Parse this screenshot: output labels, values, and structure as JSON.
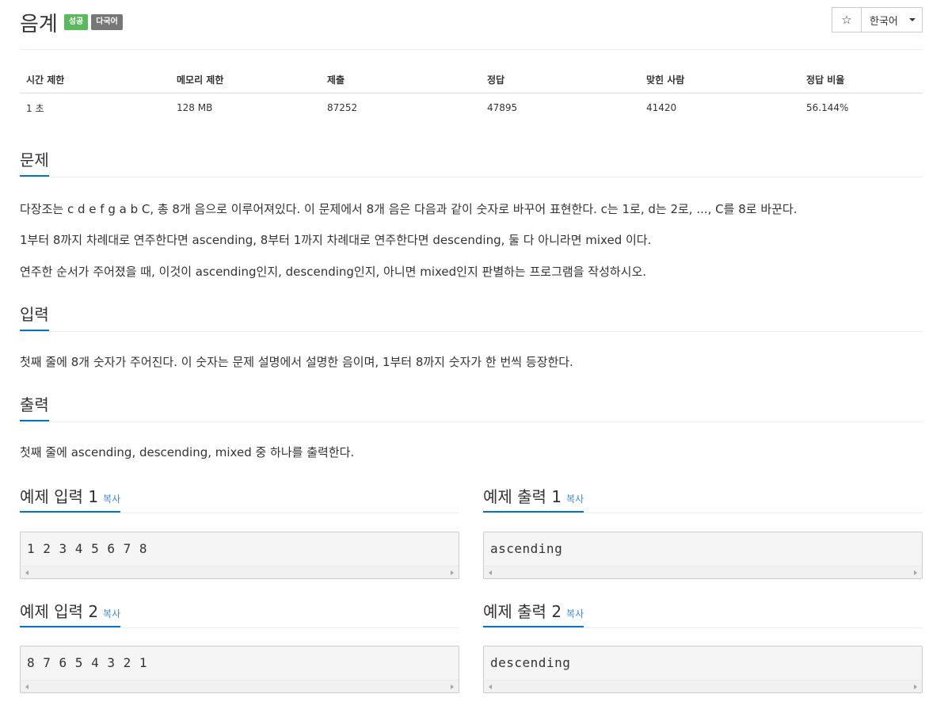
{
  "header": {
    "title": "음계",
    "badge_success": "성공",
    "badge_multilang": "다국어",
    "star_label": "☆",
    "lang_label": "한국어"
  },
  "info_table": {
    "headers": [
      "시간 제한",
      "메모리 제한",
      "제출",
      "정답",
      "맞힌 사람",
      "정답 비율"
    ],
    "values": [
      "1 초",
      "128 MB",
      "87252",
      "47895",
      "41420",
      "56.144%"
    ]
  },
  "sections": {
    "problem_title": "문제",
    "problem_p1": "다장조는 c d e f g a b C, 총 8개 음으로 이루어져있다. 이 문제에서 8개 음은 다음과 같이 숫자로 바꾸어 표현한다. c는 1로, d는 2로, ..., C를 8로 바꾼다.",
    "problem_p2": "1부터 8까지 차례대로 연주한다면 ascending, 8부터 1까지 차례대로 연주한다면 descending, 둘 다 아니라면 mixed 이다.",
    "problem_p3": "연주한 순서가 주어졌을 때, 이것이 ascending인지, descending인지, 아니면 mixed인지 판별하는 프로그램을 작성하시오.",
    "input_title": "입력",
    "input_p": "첫째 줄에 8개 숫자가 주어진다. 이 숫자는 문제 설명에서 설명한 음이며, 1부터 8까지 숫자가 한 번씩 등장한다.",
    "output_title": "출력",
    "output_p": "첫째 줄에 ascending, descending, mixed 중 하나를 출력한다."
  },
  "examples": {
    "copy_label": "복사",
    "in1_title": "예제 입력 1",
    "in1_code": "1 2 3 4 5 6 7 8",
    "out1_title": "예제 출력 1",
    "out1_code": "ascending",
    "in2_title": "예제 입력 2",
    "in2_code": "8 7 6 5 4 3 2 1",
    "out2_title": "예제 출력 2",
    "out2_code": "descending"
  },
  "colors": {
    "accent": "#0076c0",
    "success": "#5cb85c",
    "default_badge": "#777777",
    "link": "#428bca"
  }
}
